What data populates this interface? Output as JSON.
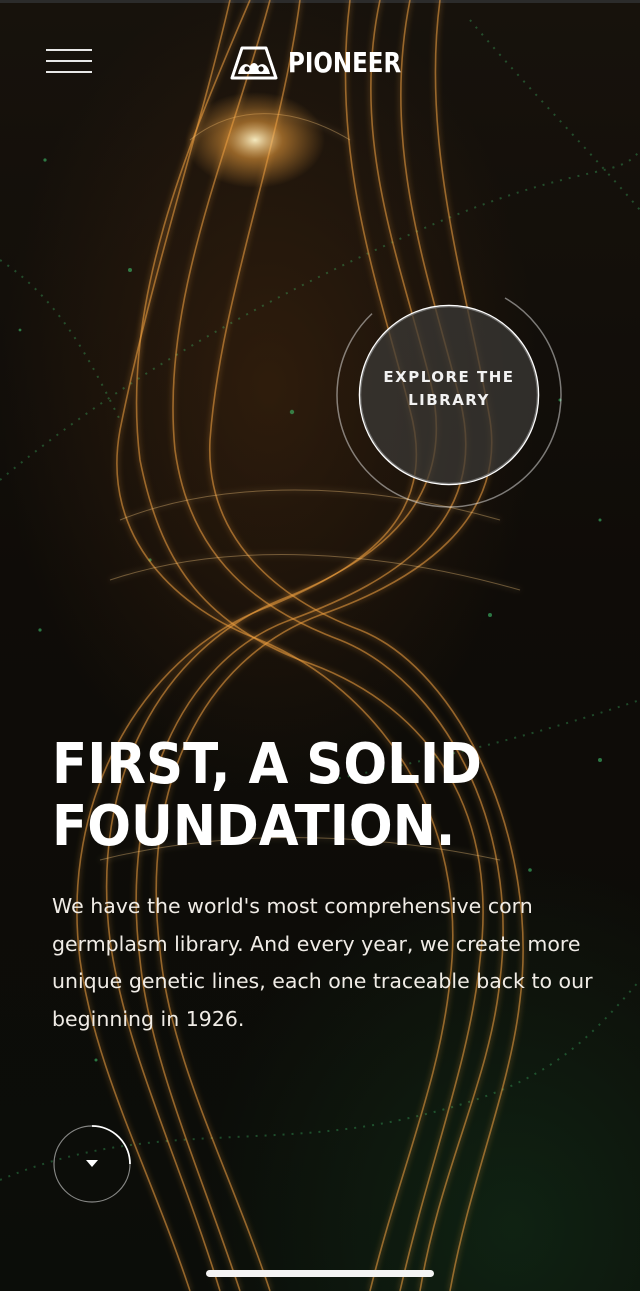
{
  "header": {
    "menu_icon": "hamburger-menu-icon",
    "brand_name": "PIONEER",
    "brand_icon": "pioneer-logo-mark"
  },
  "explore": {
    "label": "EXPLORE THE LIBRARY"
  },
  "hero": {
    "headline": "FIRST, A SOLID FOUNDATION.",
    "body": "We have the world's most comprehensive corn germplasm library. And every year, we create more unique genetic lines, each one traceable back to our beginning in 1926."
  },
  "scroll": {
    "icon": "scroll-down-triangle-icon"
  },
  "colors": {
    "background": "#0f0c08",
    "strand_gold": "#f0a040",
    "particle_green": "#3fbf6a",
    "text": "#ffffff"
  }
}
